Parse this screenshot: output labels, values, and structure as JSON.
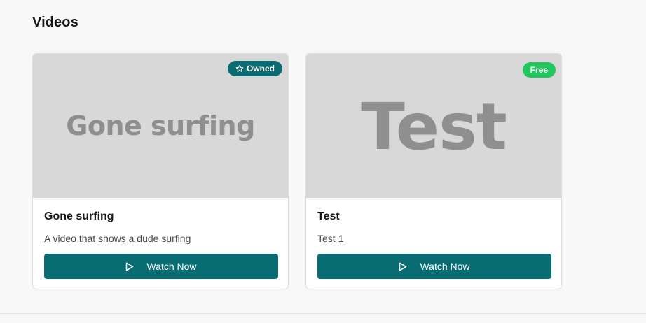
{
  "section": {
    "title": "Videos"
  },
  "cards": [
    {
      "thumbnail_text": "Gone surfing",
      "badge": "Owned",
      "badge_icon": "star-icon",
      "title": "Gone surfing",
      "description": "A video that shows a dude surfing",
      "button_label": "Watch Now",
      "button_icon": "play-icon"
    },
    {
      "thumbnail_text": "Test",
      "badge": "Free",
      "title": "Test",
      "description": "Test 1",
      "button_label": "Watch Now",
      "button_icon": "play-icon"
    }
  ],
  "colors": {
    "primary": "#086c72",
    "free_badge": "#22c55e",
    "thumbnail_bg": "#d8d8d8",
    "page_bg": "#f8f8f8"
  }
}
